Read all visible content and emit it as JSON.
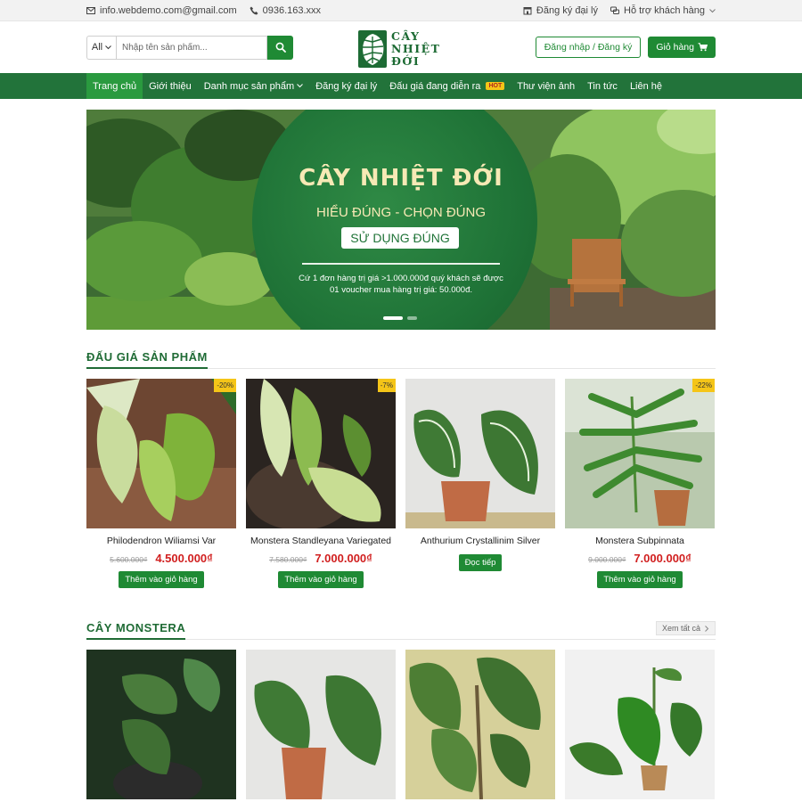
{
  "topbar": {
    "email": "info.webdemo.com@gmail.com",
    "phone": "0936.163.xxx",
    "agent_register": "Đăng ký đại lý",
    "support": "Hỗ trợ khách hàng"
  },
  "header": {
    "search_category": "All",
    "search_placeholder": "Nhập tên sản phẩm...",
    "logo_lines": [
      "CÂY",
      "NHIỆT",
      "ĐỚI"
    ],
    "login_label": "Đăng nhập / Đăng ký",
    "cart_label": "Giỏ hàng"
  },
  "nav": {
    "items": [
      {
        "label": "Trang chủ"
      },
      {
        "label": "Giới thiệu"
      },
      {
        "label": "Danh mục sản phẩm"
      },
      {
        "label": "Đăng ký đại lý"
      },
      {
        "label": "Đấu giá đang diễn ra"
      },
      {
        "label": "Thư viện ảnh"
      },
      {
        "label": "Tin tức"
      },
      {
        "label": "Liên hệ"
      }
    ],
    "hot_badge": "HOT"
  },
  "banner": {
    "title": "CÂY NHIỆT ĐỚI",
    "subtitle": "HIỂU ĐÚNG - CHỌN ĐÚNG",
    "subtitle2": "SỬ DỤNG ĐÚNG",
    "note_line1": "Cứ 1 đơn hàng trị giá >1.000.000đ quý khách sẽ được",
    "note_line2": "01 voucher mua hàng trị giá: 50.000đ."
  },
  "auction": {
    "title": "ĐẤU GIÁ SẢN PHẨM",
    "products": [
      {
        "name": "Philodendron Wiliamsi Var",
        "old_price": "5.600.000₫",
        "price": "4.500.000₫",
        "badge": "-20%",
        "button": "Thêm vào giỏ hàng"
      },
      {
        "name": "Monstera Standleyana Variegated",
        "old_price": "7.580.000₫",
        "price": "7.000.000₫",
        "badge": "-7%",
        "button": "Thêm vào giỏ hàng"
      },
      {
        "name": "Anthurium Crystallinim Silver",
        "old_price": "",
        "price": "",
        "badge": "",
        "button": "Đọc tiếp"
      },
      {
        "name": "Monstera Subpinnata",
        "old_price": "9.000.000₫",
        "price": "7.000.000₫",
        "badge": "-22%",
        "button": "Thêm vào giỏ hàng"
      }
    ]
  },
  "monstera": {
    "title": "CÂY MONSTERA",
    "view_all": "Xem tất cả"
  }
}
